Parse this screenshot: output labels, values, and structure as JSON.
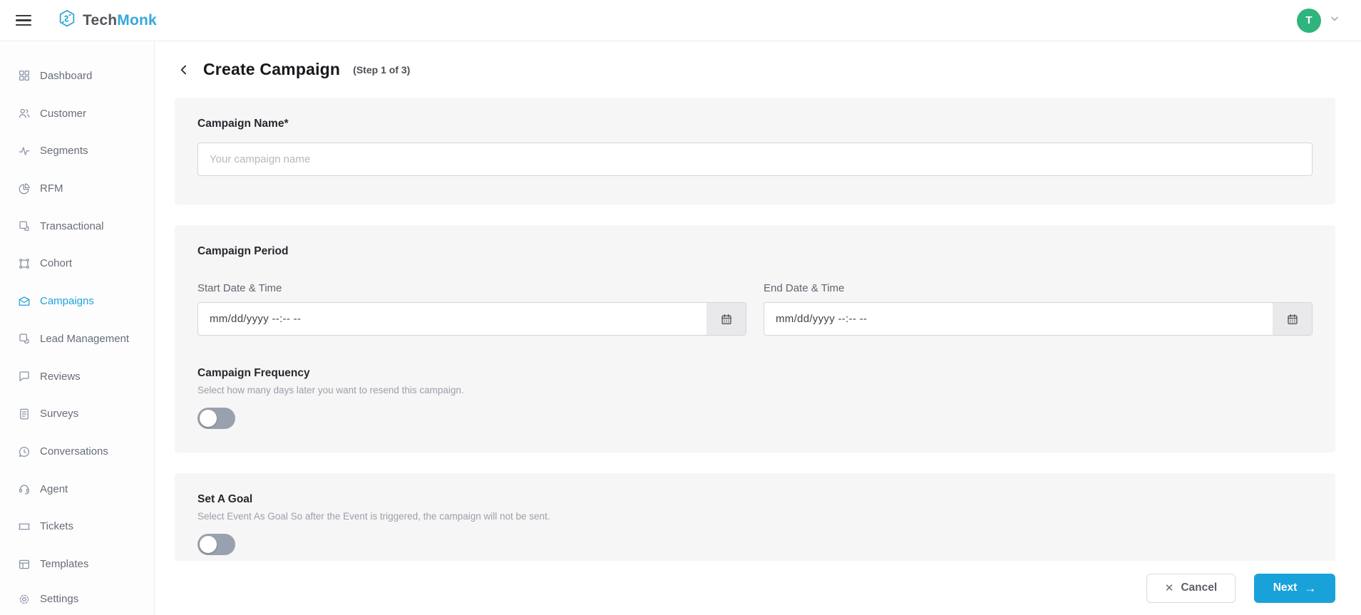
{
  "header": {
    "brand_first": "Tech",
    "brand_second": "Monk",
    "avatar_letter": "T"
  },
  "sidebar": {
    "items": [
      {
        "label": "Dashboard",
        "icon": "dashboard-grid-icon",
        "active": false
      },
      {
        "label": "Customer",
        "icon": "customers-icon",
        "active": false
      },
      {
        "label": "Segments",
        "icon": "activity-icon",
        "active": false
      },
      {
        "label": "RFM",
        "icon": "pie-chart-icon",
        "active": false
      },
      {
        "label": "Transactional",
        "icon": "copy-doc-icon",
        "active": false
      },
      {
        "label": "Cohort",
        "icon": "cohort-icon",
        "active": false
      },
      {
        "label": "Campaigns",
        "icon": "campaign-mail-icon",
        "active": true
      },
      {
        "label": "Lead Management",
        "icon": "copy-doc-icon",
        "active": false
      },
      {
        "label": "Reviews",
        "icon": "chat-bubble-icon",
        "active": false
      },
      {
        "label": "Surveys",
        "icon": "document-icon",
        "active": false
      },
      {
        "label": "Conversations",
        "icon": "chat-clock-icon",
        "active": false
      },
      {
        "label": "Agent",
        "icon": "headset-icon",
        "active": false
      },
      {
        "label": "Tickets",
        "icon": "ticket-icon",
        "active": false
      },
      {
        "label": "Templates",
        "icon": "layout-icon",
        "active": false
      },
      {
        "label": "Settings",
        "icon": "gear-icon",
        "active": false
      }
    ]
  },
  "page": {
    "title": "Create Campaign",
    "step": "(Step 1 of 3)"
  },
  "form": {
    "campaign_name": {
      "label": "Campaign Name*",
      "placeholder": "Your campaign name",
      "value": ""
    },
    "campaign_period": {
      "heading": "Campaign Period",
      "start_label": "Start Date & Time",
      "end_label": "End Date & Time",
      "date_placeholder": "mm/dd/yyyy --:-- --"
    },
    "campaign_frequency": {
      "heading": "Campaign Frequency",
      "subtitle": "Select how many days later you want to resend this campaign.",
      "toggle_state": "off"
    },
    "set_a_goal": {
      "heading": "Set A Goal",
      "subtitle": "Select Event As Goal So after the Event is triggered, the campaign will not be sent.",
      "toggle_state": "off"
    }
  },
  "footer": {
    "cancel_label": "Cancel",
    "next_label": "Next"
  },
  "colors": {
    "brand_blue": "#18a2d9",
    "logo_blue": "#35a7dc",
    "avatar_green": "#2fb47e",
    "toggle_off_track": "#9aa1ae",
    "card_background": "#f6f6f7"
  }
}
